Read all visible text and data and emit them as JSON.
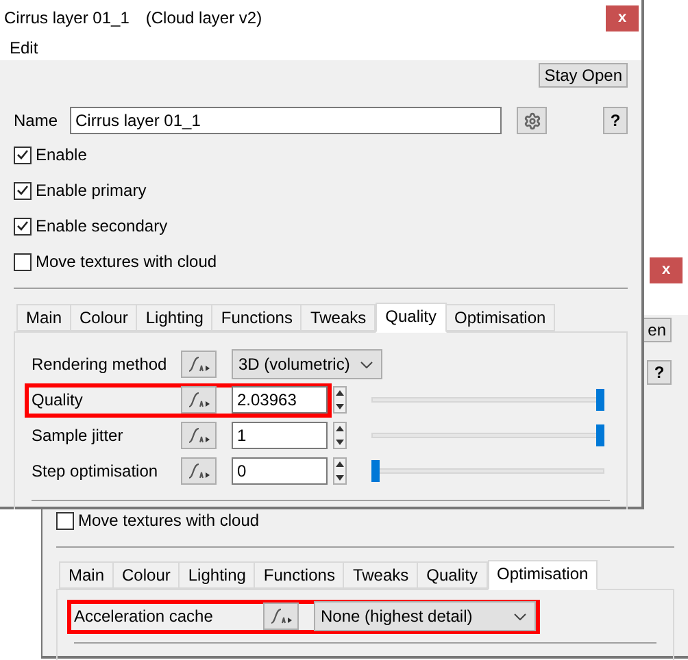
{
  "back_window": {
    "close_button": "x",
    "stay_open_button": "en",
    "help_button": "?",
    "checkboxes": [
      {
        "label": "Move textures with cloud",
        "checked": false
      }
    ],
    "tabs": [
      {
        "label": "Main",
        "selected": false
      },
      {
        "label": "Colour",
        "selected": false
      },
      {
        "label": "Lighting",
        "selected": false
      },
      {
        "label": "Functions",
        "selected": false
      },
      {
        "label": "Tweaks",
        "selected": false
      },
      {
        "label": "Quality",
        "selected": false
      },
      {
        "label": "Optimisation",
        "selected": true
      }
    ],
    "rows": [
      {
        "kind": "dropdown",
        "label": "Acceleration cache",
        "value": "None (highest detail)",
        "highlighted": true
      }
    ]
  },
  "front_window": {
    "title": "Cirrus layer 01_1",
    "subtitle": "(Cloud layer v2)",
    "close_button": "x",
    "menu": [
      "Edit"
    ],
    "stay_open_button": "Stay Open",
    "name_label": "Name",
    "name_value": "Cirrus layer 01_1",
    "help_button": "?",
    "checkboxes": [
      {
        "label": "Enable",
        "checked": true
      },
      {
        "label": "Enable primary",
        "checked": true
      },
      {
        "label": "Enable secondary",
        "checked": true
      },
      {
        "label": "Move textures with cloud",
        "checked": false
      }
    ],
    "tabs": [
      {
        "label": "Main",
        "selected": false
      },
      {
        "label": "Colour",
        "selected": false
      },
      {
        "label": "Lighting",
        "selected": false
      },
      {
        "label": "Functions",
        "selected": false
      },
      {
        "label": "Tweaks",
        "selected": false
      },
      {
        "label": "Quality",
        "selected": true
      },
      {
        "label": "Optimisation",
        "selected": false
      }
    ],
    "rows": [
      {
        "kind": "dropdown",
        "label": "Rendering method",
        "value": "3D (volumetric)",
        "highlighted": false
      },
      {
        "kind": "slider",
        "label": "Quality",
        "value": "2.03963",
        "level": 1,
        "highlighted": true
      },
      {
        "kind": "slider",
        "label": "Sample jitter",
        "value": "1",
        "level": 1,
        "highlighted": false
      },
      {
        "kind": "slider",
        "label": "Step optimisation",
        "value": "0",
        "level": 0,
        "highlighted": false
      }
    ]
  }
}
